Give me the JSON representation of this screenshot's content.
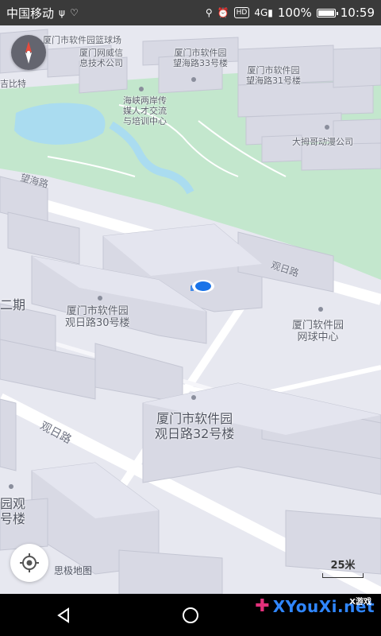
{
  "status_bar": {
    "carrier": "中国移动",
    "signal_label": "4G",
    "battery": "100%",
    "time": "10:59"
  },
  "map": {
    "labels": {
      "lanqiu": "厦门市软件园篮球场",
      "wangwei": "厦门网威信\n息技术公司",
      "bldg33": "厦门市软件园\n望海路33号楼",
      "jibisi": "吉比特",
      "bldg31": "厦门市软件园\n望海路31号楼",
      "haixia": "海峡两岸传\n媒人才交流\n与培训中心",
      "dashijie": "大拇哥动漫公司",
      "erqi": "二期",
      "bldg30": "厦门市软件园\n观日路30号楼",
      "tennis": "厦门软件园\n网球中心",
      "bldg32": "厦门市软件园\n观日路32号楼",
      "yuanguan": "园观\n号楼",
      "guanri_road_1": "观日路",
      "guanri_road_2": "观日路",
      "road_top": "望海路"
    },
    "attribution": "思极地图",
    "scale": "25米"
  },
  "icons": {
    "compass": "compass-icon",
    "locate": "locate-icon",
    "back": "back-icon",
    "home": "home-icon"
  },
  "watermark": {
    "brand": "XYouXi.net",
    "tag": "X游戏"
  },
  "colors": {
    "park": "#b9e2c4",
    "water": "#aadcf0",
    "building": "#d6d7e2",
    "road": "#ffffff",
    "user_dot": "#1a73e8"
  }
}
